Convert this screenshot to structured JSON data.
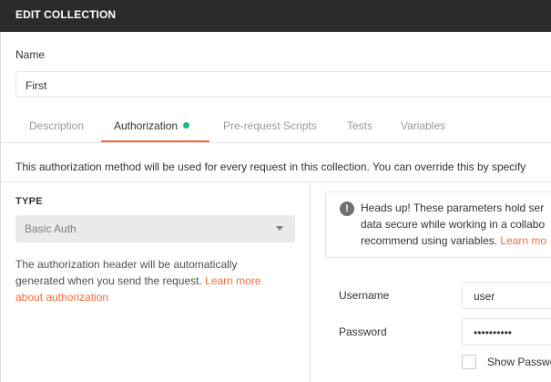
{
  "header": {
    "title": "EDIT COLLECTION"
  },
  "name_field": {
    "label": "Name",
    "value": "First"
  },
  "tabs": [
    {
      "label": "Description",
      "active": false
    },
    {
      "label": "Authorization",
      "active": true,
      "indicator_color": "#26b47f"
    },
    {
      "label": "Pre-request Scripts",
      "active": false
    },
    {
      "label": "Tests",
      "active": false
    },
    {
      "label": "Variables",
      "active": false
    }
  ],
  "auth": {
    "info_text": "This authorization method will be used for every request in this collection. You can override this by specify",
    "type_label": "TYPE",
    "type_value": "Basic Auth",
    "help_text": "The authorization header will be automatically generated when you send the request. ",
    "help_link": "Learn more about authorization",
    "notice": {
      "icon": "exclamation-icon",
      "line1": "Heads up! These parameters hold ser",
      "line2": "data secure while working in a collabo",
      "line3": "recommend using variables. ",
      "link": "Learn mo"
    },
    "username_label": "Username",
    "username_value": "user",
    "password_label": "Password",
    "password_value": "••••••••••",
    "show_password_label": "Show Passwo"
  },
  "colors": {
    "header_bg": "#2b2b2b",
    "accent": "#f26b3a",
    "active_dot": "#26b47f"
  }
}
